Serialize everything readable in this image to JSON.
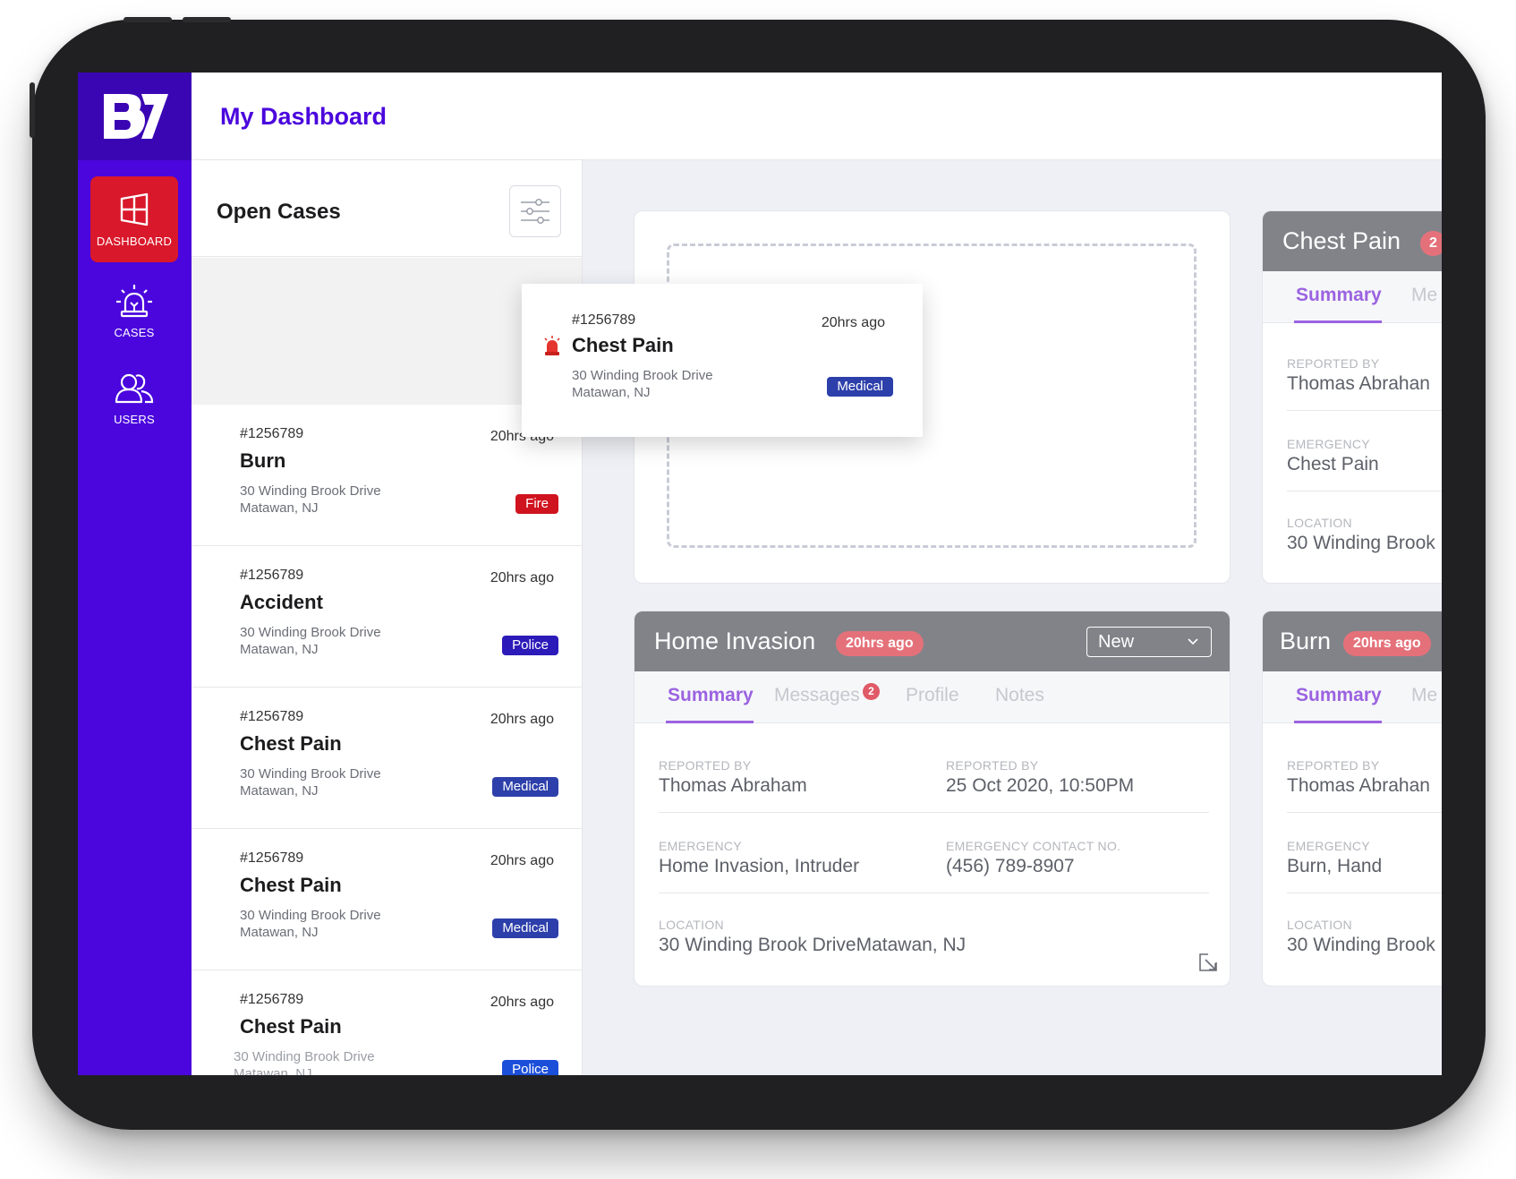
{
  "app": {
    "logo_text": "B7",
    "header_title": "My Dashboard"
  },
  "sidebar": {
    "items": [
      {
        "label": "DASHBOARD",
        "icon": "dashboard-icon",
        "active": true
      },
      {
        "label": "CASES",
        "icon": "siren-icon",
        "active": false
      },
      {
        "label": "USERS",
        "icon": "users-icon",
        "active": false
      }
    ]
  },
  "cases": {
    "title": "Open Cases",
    "filter_icon": "sliders-icon",
    "items": [
      {
        "id": "#1256789",
        "time": "20hrs ago",
        "title": "Burn",
        "address_line1": "30 Winding Brook Drive",
        "address_line2": "Matawan, NJ",
        "tag": "Fire"
      },
      {
        "id": "#1256789",
        "time": "20hrs ago",
        "title": "Accident",
        "address_line1": "30 Winding Brook Drive",
        "address_line2": "Matawan, NJ",
        "tag": "Police"
      },
      {
        "id": "#1256789",
        "time": "20hrs ago",
        "title": "Chest Pain",
        "address_line1": "30 Winding Brook Drive",
        "address_line2": "Matawan, NJ",
        "tag": "Medical"
      },
      {
        "id": "#1256789",
        "time": "20hrs ago",
        "title": "Chest Pain",
        "address_line1": "30 Winding Brook Drive",
        "address_line2": "Matawan, NJ",
        "tag": "Medical"
      },
      {
        "id": "#1256789",
        "time": "20hrs ago",
        "title": "Chest Pain",
        "address_line1": "30 Winding Brook Drive",
        "address_line2": "Matawan, NJ",
        "tag": "Police"
      }
    ]
  },
  "dragged_card": {
    "id": "#1256789",
    "time": "20hrs ago",
    "title": "Chest Pain",
    "address_line1": "30 Winding Brook Drive",
    "address_line2": "Matawan, NJ",
    "tag": "Medical",
    "icon": "siren-icon"
  },
  "detail_cards": {
    "chest_pain": {
      "title": "Chest Pain",
      "badge": "2",
      "tabs": [
        "Summary",
        "Me"
      ],
      "fields": [
        {
          "label": "REPORTED BY",
          "value": "Thomas Abrahan"
        },
        {
          "label": "EMERGENCY",
          "value": "Chest Pain"
        },
        {
          "label": "LOCATION",
          "value": "30 Winding Brook"
        }
      ]
    },
    "home_invasion": {
      "title": "Home Invasion",
      "time_badge": "20hrs ago",
      "status": "New",
      "tabs": [
        {
          "label": "Summary"
        },
        {
          "label": "Messages",
          "count": "2"
        },
        {
          "label": "Profile"
        },
        {
          "label": "Notes"
        }
      ],
      "fields": {
        "reported_by_label": "REPORTED BY",
        "reported_by": "Thomas Abraham",
        "reported_at_label": "REPORTED BY",
        "reported_at": "25 Oct 2020, 10:50PM",
        "emergency_label": "EMERGENCY",
        "emergency": "Home Invasion, Intruder",
        "contact_label": "EMERGENCY CONTACT NO.",
        "contact": "(456) 789-8907",
        "location_label": "LOCATION",
        "location": "30 Winding Brook DriveMatawan, NJ"
      }
    },
    "burn": {
      "title": "Burn",
      "time_badge": "20hrs ago",
      "tabs": [
        "Summary",
        "Me"
      ],
      "fields": [
        {
          "label": "REPORTED BY",
          "value": "Thomas Abrahan"
        },
        {
          "label": "EMERGENCY",
          "value": "Burn, Hand"
        },
        {
          "label": "LOCATION",
          "value": "30 Winding Brook"
        }
      ]
    }
  },
  "colors": {
    "sidebar": "#4a06dd",
    "active_nav": "#d9182b",
    "header_title": "#4a06dd",
    "tab_active": "#9b63e0",
    "fire": "#d0141f",
    "police": "#2c1ab9",
    "medical": "#2d3faa",
    "card_header": "#828389",
    "time_pill": "#e4717a"
  }
}
